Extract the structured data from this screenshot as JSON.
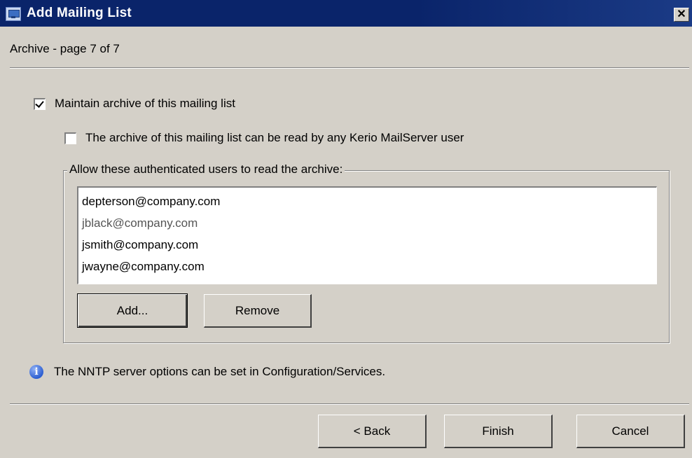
{
  "window": {
    "title": "Add Mailing List",
    "close_glyph": "✕"
  },
  "page": {
    "label": "Archive - page 7 of 7"
  },
  "archive": {
    "maintain_label": "Maintain archive of this mailing list",
    "maintain_checked": true,
    "any_user_label": "The archive of this mailing list can be read by any Kerio MailServer user",
    "any_user_checked": false,
    "group_label": "Allow these authenticated users to read the archive:",
    "users": [
      "depterson@company.com",
      "jblack@company.com",
      "jsmith@company.com",
      "jwayne@company.com"
    ],
    "add_label": "Add...",
    "remove_label": "Remove"
  },
  "info": {
    "icon": "info-icon",
    "text": "The NNTP server options can be set in Configuration/Services."
  },
  "footer": {
    "back_label": "< Back",
    "finish_label": "Finish",
    "cancel_label": "Cancel"
  }
}
